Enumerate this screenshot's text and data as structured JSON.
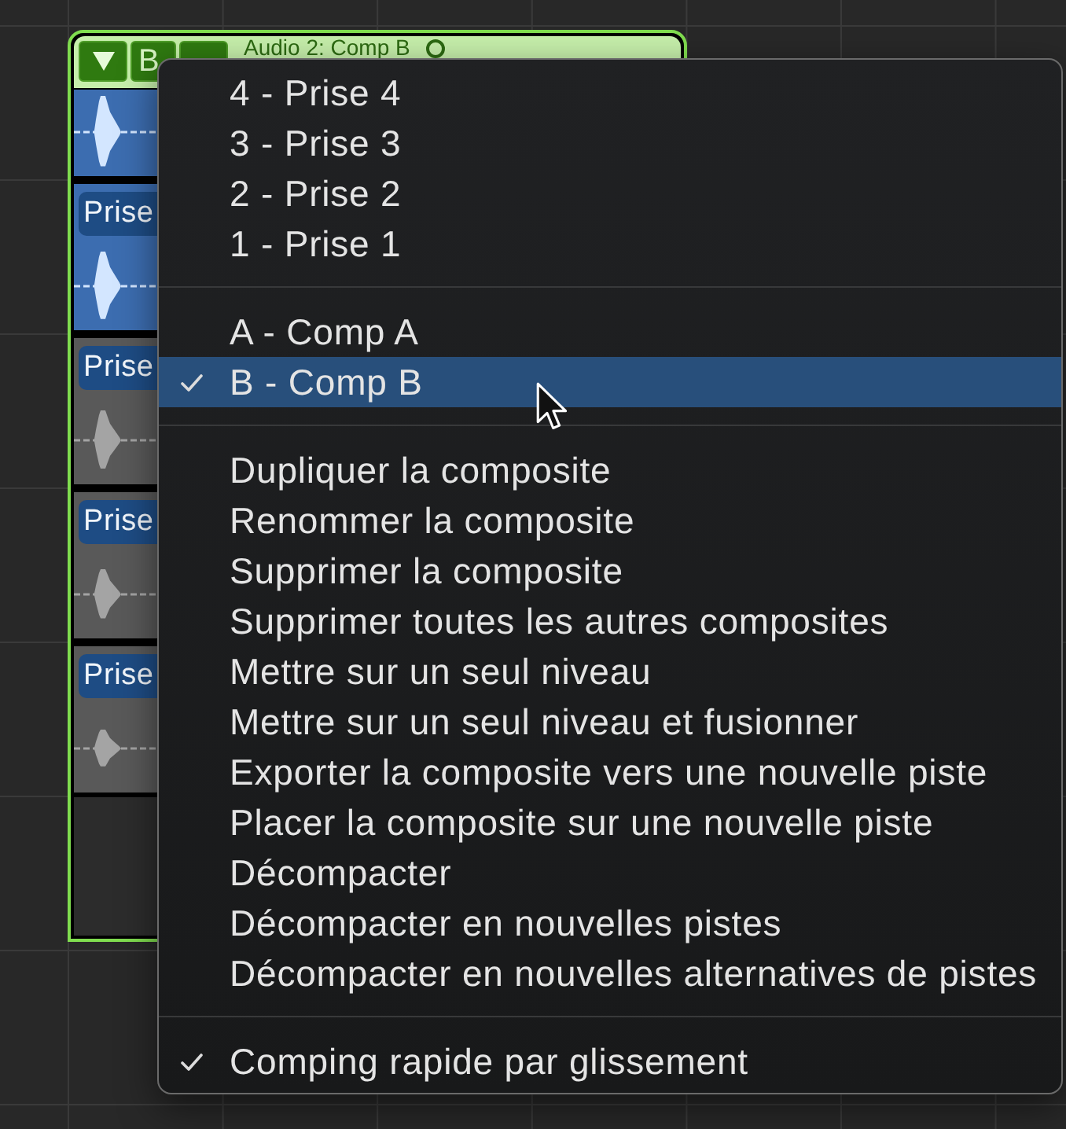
{
  "take_folder": {
    "title": "Audio 2: Comp B",
    "expanded": true,
    "comp_button": "B",
    "lanes": [
      {
        "kind": "comp",
        "active": true
      },
      {
        "kind": "take",
        "label": "Prise",
        "active": true
      },
      {
        "kind": "take",
        "label": "Prise",
        "active": false
      },
      {
        "kind": "take",
        "label": "Prise",
        "active": false
      },
      {
        "kind": "take",
        "label": "Prise",
        "active": false
      }
    ]
  },
  "context_menu": {
    "sections": [
      {
        "items": [
          {
            "label": "4 - Prise 4",
            "checked": false,
            "highlighted": false
          },
          {
            "label": "3 - Prise 3",
            "checked": false,
            "highlighted": false
          },
          {
            "label": "2 - Prise 2",
            "checked": false,
            "highlighted": false
          },
          {
            "label": "1 - Prise 1",
            "checked": false,
            "highlighted": false
          }
        ]
      },
      {
        "items": [
          {
            "label": "A - Comp A",
            "checked": false,
            "highlighted": false
          },
          {
            "label": "B - Comp B",
            "checked": true,
            "highlighted": true
          }
        ]
      },
      {
        "items": [
          {
            "label": "Dupliquer la composite",
            "checked": false,
            "highlighted": false
          },
          {
            "label": "Renommer la composite",
            "checked": false,
            "highlighted": false
          },
          {
            "label": "Supprimer la composite",
            "checked": false,
            "highlighted": false
          },
          {
            "label": "Supprimer toutes les autres composites",
            "checked": false,
            "highlighted": false
          },
          {
            "label": "Mettre sur un seul niveau",
            "checked": false,
            "highlighted": false
          },
          {
            "label": "Mettre sur un seul niveau et fusionner",
            "checked": false,
            "highlighted": false
          },
          {
            "label": "Exporter la composite vers une nouvelle piste",
            "checked": false,
            "highlighted": false
          },
          {
            "label": "Placer la composite sur une nouvelle piste",
            "checked": false,
            "highlighted": false
          },
          {
            "label": "Décompacter",
            "checked": false,
            "highlighted": false
          },
          {
            "label": "Décompacter en nouvelles pistes",
            "checked": false,
            "highlighted": false
          },
          {
            "label": "Décompacter en nouvelles alternatives de pistes",
            "checked": false,
            "highlighted": false
          }
        ]
      },
      {
        "items": [
          {
            "label": "Comping rapide par glissement",
            "checked": true,
            "highlighted": false
          }
        ]
      }
    ]
  }
}
